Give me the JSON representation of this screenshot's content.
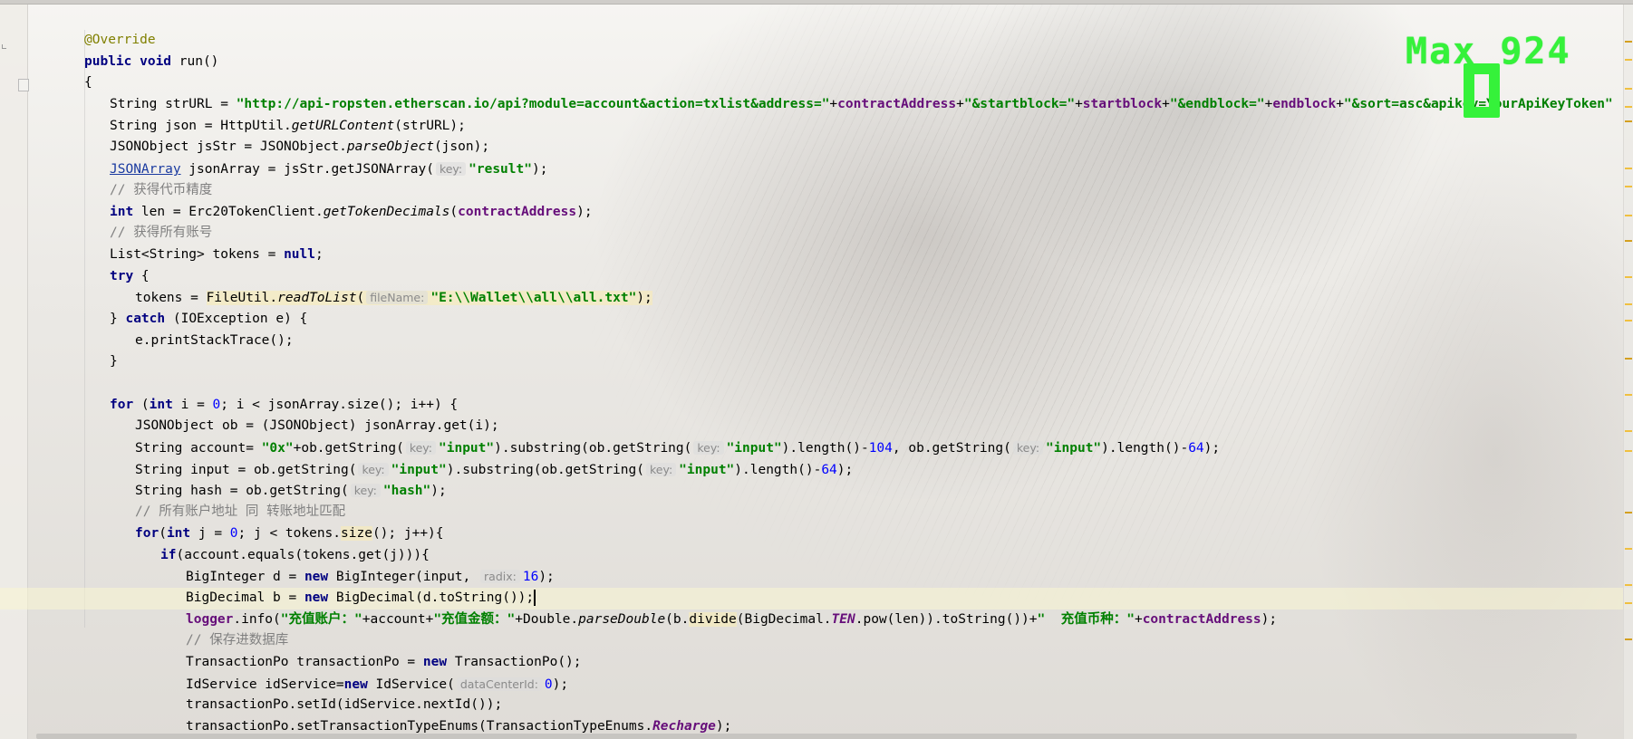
{
  "editor": {
    "overlay": {
      "max_label": "Max 924",
      "zero_label": "0"
    },
    "lines": [
      {
        "type": "ann",
        "text": "@Override"
      },
      {
        "type": "sig",
        "kw": "public void",
        "text": " run()"
      },
      {
        "type": "plain",
        "text": "{"
      },
      {
        "type": "strurl",
        "prefix": "String strURL = ",
        "str1": "\"http://api-ropsten.etherscan.io/api?module=account&action=txlist&address=\"",
        "plus1": "+",
        "f1": "contractAddress",
        "plus2": "+",
        "str2": "\"&startblock=\"",
        "plus3": "+",
        "f2": "startblock",
        "plus4": "+",
        "str3": "\"&endblock=\"",
        "plus5": "+",
        "f3": "endblock",
        "plus6": "+",
        "str4": "\"&sort=asc&apikey=YourApiKeyToken\""
      },
      {
        "type": "plain",
        "text": "String json = HttpUtil.",
        "italic": "getURLContent",
        "after": "(strURL);"
      },
      {
        "type": "plain",
        "text": "JSONObject jsStr = JSONObject.",
        "italic": "parseObject",
        "after": "(json);"
      },
      {
        "type": "jsonarray",
        "link": "JSONArray",
        "text": " jsonArray = jsStr.getJSONArray(",
        "hint": "key:",
        "str": "\"result\"",
        "after": ");"
      },
      {
        "type": "cmt",
        "text": "// 获得代币精度"
      },
      {
        "type": "intlen",
        "kw": "int",
        "text": " len = Erc20TokenClient.",
        "italic": "getTokenDecimals",
        "paren": "(",
        "field": "contractAddress",
        "after": ");"
      },
      {
        "type": "cmt",
        "text": "// 获得所有账号"
      },
      {
        "type": "list",
        "text": "List<String> tokens = ",
        "kw": "null",
        "after": ";"
      },
      {
        "type": "kwline",
        "kw": "try",
        "after": " {"
      },
      {
        "type": "readfile",
        "text": "tokens = ",
        "warn": "FileUtil.",
        "italic": "readToList",
        "paren": "(",
        "hint": "fileName:",
        "str": "\"E:\\\\Wallet\\\\all\\\\all.txt\"",
        "after": ");"
      },
      {
        "type": "catch",
        "pre": "} ",
        "kw": "catch",
        "after": " (IOException e) {"
      },
      {
        "type": "plain",
        "text": "e.printStackTrace();"
      },
      {
        "type": "plain",
        "text": "}"
      },
      {
        "type": "blank",
        "text": ""
      },
      {
        "type": "forline",
        "kw1": "for",
        "a": " (",
        "kw2": "int",
        "b": " i = ",
        "n": "0",
        "c": "; i < jsonArray.size(); i++) {"
      },
      {
        "type": "plain",
        "text": "JSONObject ob = (JSONObject) jsonArray.get(i);"
      },
      {
        "type": "account"
      },
      {
        "type": "input"
      },
      {
        "type": "hash"
      },
      {
        "type": "cmt",
        "text": "// 所有账户地址 同 转账地址匹配"
      },
      {
        "type": "forj"
      },
      {
        "type": "ifline"
      },
      {
        "type": "bigint"
      },
      {
        "type": "bigdec"
      },
      {
        "type": "logger"
      },
      {
        "type": "cmt",
        "text": "// 保存进数据库"
      },
      {
        "type": "txpo"
      },
      {
        "type": "idsvc"
      },
      {
        "type": "setid",
        "text": "transactionPo.setId(idService.nextId());"
      },
      {
        "type": "settype"
      }
    ],
    "strings": {
      "account_pre": "String account= ",
      "account_0x": "\"0x\"",
      "account_a": "+ob.getString(",
      "key_hint": "key:",
      "input_str": "\"input\"",
      "account_b": ").substring(ob.getString(",
      "account_c": ").length()-",
      "n104": "104",
      "account_d": ", ob.getString(",
      "n64": "64",
      "close_semi": ");",
      "input_pre": "String input = ob.getString(",
      "input_b": ").substring(ob.getString(",
      "input_c": ").length()-",
      "hash_pre": "String hash = ob.getString(",
      "hash_str": "\"hash\"",
      "forj_kw": "for",
      "forj_a": "(",
      "forj_int": "int",
      "forj_b": " j = ",
      "n0": "0",
      "forj_c": "; j < tokens.",
      "forj_size": "size",
      "forj_d": "(); j++){",
      "if_kw": "if",
      "if_rest": "(account.equals(tokens.get(j))){",
      "bigint_pre": "BigInteger d = ",
      "new_kw": "new",
      "bigint_b": " BigInteger(input, ",
      "radix_hint": "radix:",
      "n16": "16",
      "bigint_c": ");",
      "bigdec_pre": "BigDecimal b = ",
      "bigdec_b": " BigDecimal(d.toString());",
      "logger": "logger",
      "logger_a": ".info(",
      "logger_s1": "\"充值账户：\"",
      "logger_b": "+account+",
      "logger_s2": "\"充值金额：\"",
      "logger_c": "+Double.",
      "logger_parse": "parseDouble",
      "logger_d": "(b.",
      "logger_divide": "divide",
      "logger_e": "(BigDecimal.",
      "logger_ten": "TEN",
      "logger_f": ".pow(len)).toString())+",
      "logger_s3": "\"  充值币种：\"",
      "logger_g": "+",
      "logger_field": "contractAddress",
      "logger_h": ");",
      "txpo_pre": "TransactionPo transactionPo = ",
      "txpo_b": " TransactionPo();",
      "idsvc_pre": "IdService idService=",
      "idsvc_b": " IdService(",
      "dc_hint": "dataCenterId:",
      "idsvc_c": ");",
      "settype_pre": "transactionPo.setTransactionTypeEnums(TransactionTypeEnums.",
      "settype_recharge": "Recharge",
      "settype_post": ");"
    }
  },
  "colors": {
    "keyword": "#000080",
    "string": "#008000",
    "number": "#0000ff",
    "field": "#660e7a",
    "comment": "#808080",
    "overlay": "#35f23a"
  }
}
